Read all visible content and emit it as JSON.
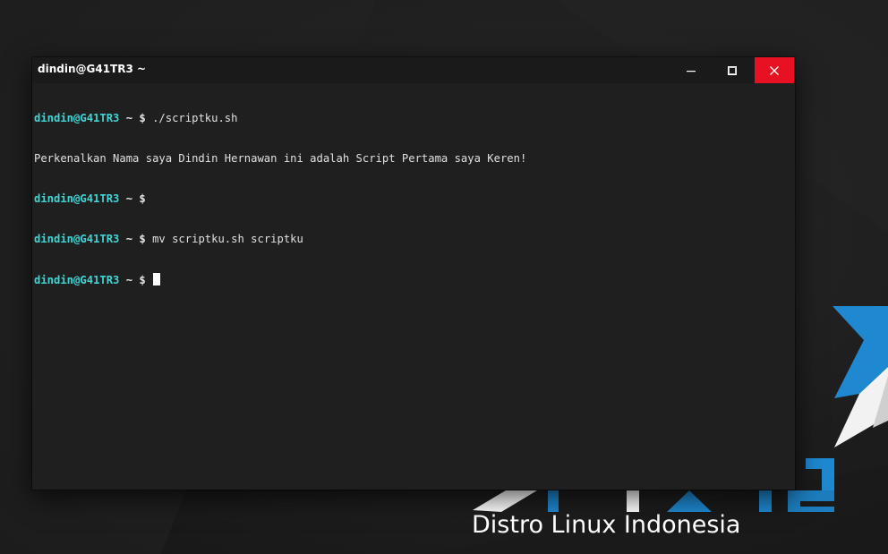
{
  "window": {
    "title": "dindin@G41TR3 ~",
    "controls": {
      "minimize": "minimize-icon",
      "maximize": "maximize-icon",
      "close": "close-icon"
    },
    "close_color": "#e81123"
  },
  "terminal": {
    "lines": [
      {
        "user": "dindin@G41TR3",
        "rest": " ~ $",
        "cmd": " ./scriptku.sh"
      },
      {
        "output": "Perkenalkan Nama saya Dindin Hernawan ini adalah Script Pertama saya Keren!"
      },
      {
        "user": "dindin@G41TR3",
        "rest": " ~ $",
        "cmd": ""
      },
      {
        "user": "dindin@G41TR3",
        "rest": " ~ $",
        "cmd": " mv scriptku.sh scriptku"
      },
      {
        "user": "dindin@G41TR3",
        "rest": " ~ $",
        "cmd": " "
      }
    ],
    "prompt_color": "#3fd5d5"
  },
  "wallpaper": {
    "tagline": "Distro Linux Indonesia",
    "accent": "#1e88d0"
  }
}
